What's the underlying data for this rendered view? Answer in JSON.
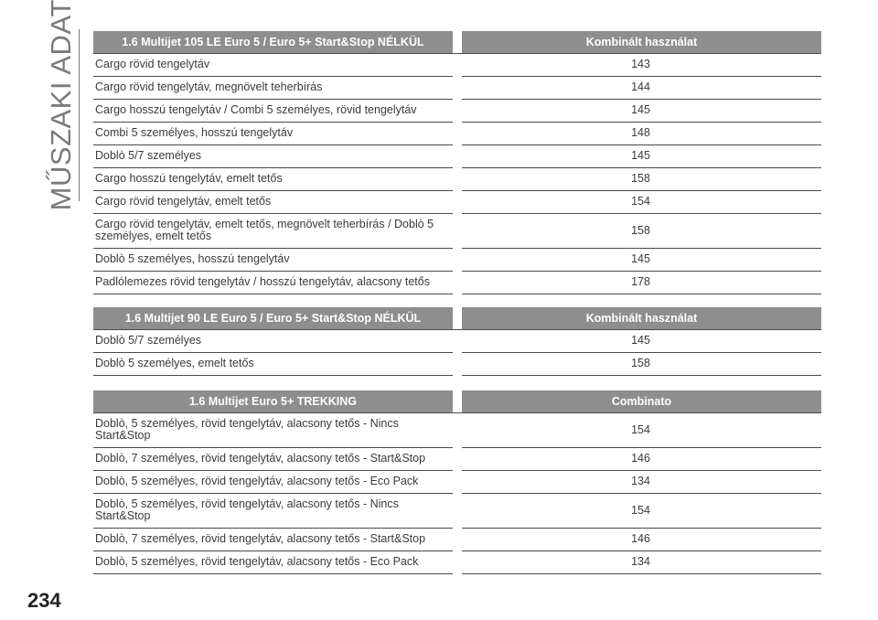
{
  "side_title": "MŰSZAKI ADATOK",
  "page_number": "234",
  "tables": [
    {
      "header": [
        "1.6 Multijet 105 LE Euro 5 / Euro 5+ Start&Stop NÉLKÜL",
        "Kombinált használat"
      ],
      "rows": [
        [
          "Cargo rövid tengelytáv",
          "143"
        ],
        [
          "Cargo rövid tengelytáv, megnövelt teherbírás",
          "144"
        ],
        [
          "Cargo hosszú tengelytáv / Combi 5 személyes, rövid tengelytáv",
          "145"
        ],
        [
          "Combi 5 személyes, hosszú tengelytáv",
          "148"
        ],
        [
          "Doblò 5/7 személyes",
          "145"
        ],
        [
          "Cargo hosszú tengelytáv, emelt tetős",
          "158"
        ],
        [
          "Cargo rövid tengelytáv, emelt tetős",
          "154"
        ],
        [
          "Cargo rövid tengelytáv, emelt tetős, megnövelt teherbírás / Doblò 5\nszemélyes, emelt tetős",
          "158"
        ],
        [
          "Doblò 5 személyes, hosszú tengelytáv",
          "145"
        ],
        [
          "Padlólemezes rövid tengelytáv / hosszú tengelytáv, alacsony tetős",
          "178"
        ]
      ]
    },
    {
      "header": [
        "1.6 Multijet 90 LE Euro 5 / Euro 5+ Start&Stop NÉLKÜL",
        "Kombinált használat"
      ],
      "rows": [
        [
          "Doblò 5/7 személyes",
          "145"
        ],
        [
          "Doblò 5 személyes, emelt tetős",
          "158"
        ]
      ]
    },
    {
      "header": [
        "1.6 Multijet Euro 5+ TREKKING",
        "Combinato"
      ],
      "rows": [
        [
          "Doblò, 5 személyes, rövid tengelytáv, alacsony tetős - Nincs\nStart&Stop",
          "154"
        ],
        [
          "Doblò, 7 személyes, rövid tengelytáv, alacsony tetős - Start&Stop",
          "146"
        ],
        [
          "Doblò, 5 személyes, rövid tengelytáv, alacsony tetős - Eco Pack",
          "134"
        ],
        [
          "Doblò, 5 személyes, rövid tengelytáv, alacsony tetős - Nincs\nStart&Stop",
          "154"
        ],
        [
          "Doblò, 7 személyes, rövid tengelytáv, alacsony tetős - Start&Stop",
          "146"
        ],
        [
          "Doblò, 5 személyes, rövid tengelytáv, alacsony tetős - Eco Pack",
          "134"
        ]
      ]
    }
  ]
}
